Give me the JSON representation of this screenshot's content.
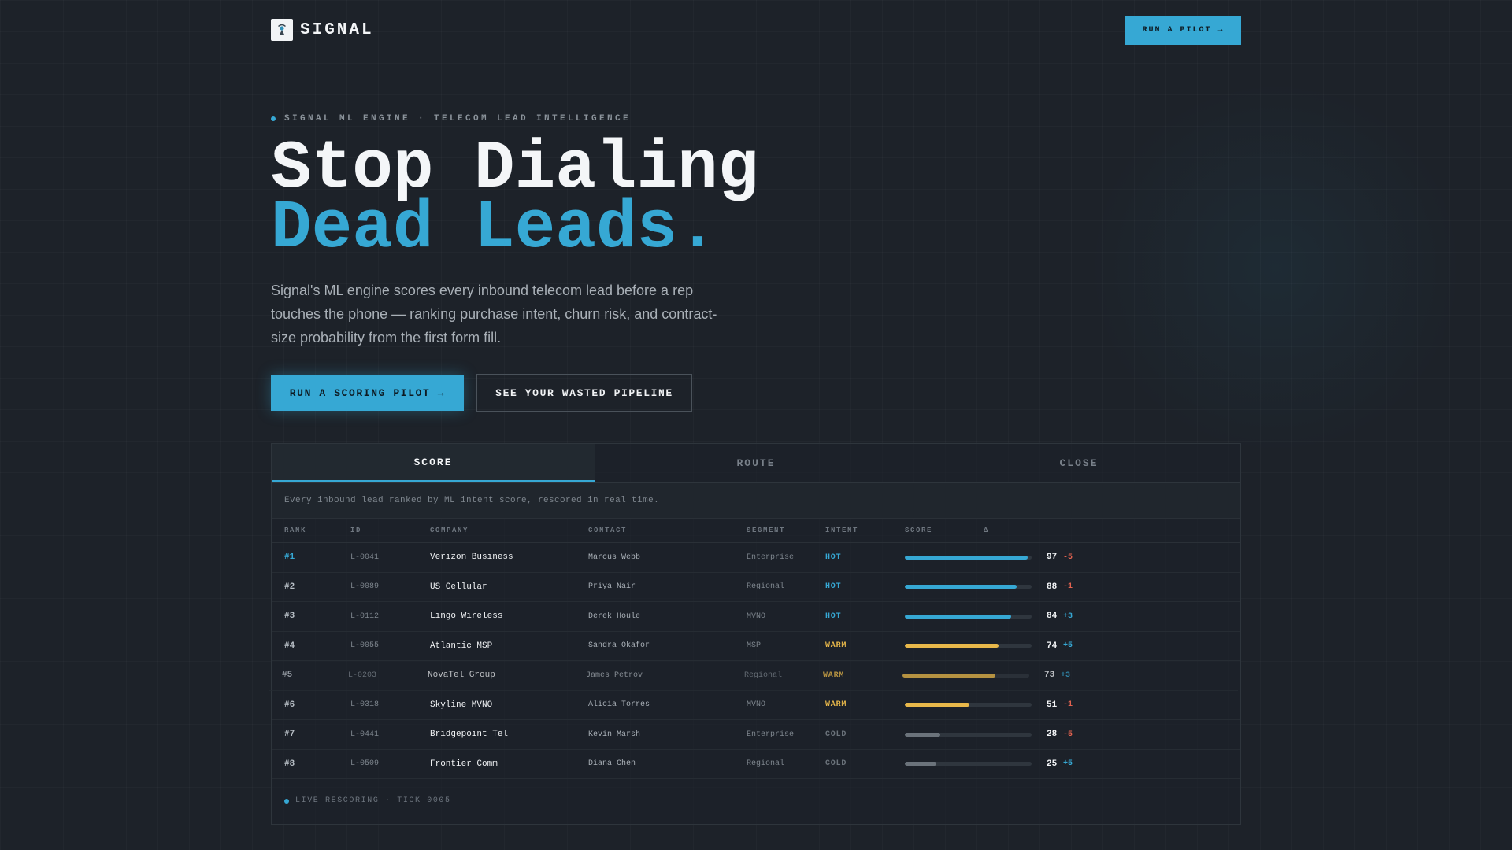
{
  "brand": {
    "name": "SIGNAL"
  },
  "nav": {
    "cta_label": "RUN A PILOT →"
  },
  "hero": {
    "eyebrow": "SIGNAL ML ENGINE · TELECOM LEAD INTELLIGENCE",
    "headline_line1": "Stop Dialing",
    "headline_line2": "Dead Leads.",
    "subtext": "Signal's ML engine scores every inbound telecom lead before a rep touches the phone — ranking purchase intent, churn risk, and contract-size probability from the first form fill.",
    "primary_cta": "RUN A SCORING PILOT →",
    "secondary_cta": "SEE YOUR WASTED PIPELINE"
  },
  "panel": {
    "tabs": [
      "SCORE",
      "ROUTE",
      "CLOSE"
    ],
    "active_tab": "SCORE",
    "caption": "Every inbound lead ranked by ML intent score, rescored in real time.",
    "columns": [
      "RANK",
      "ID",
      "COMPANY",
      "CONTACT",
      "SEGMENT",
      "INTENT",
      "SCORE",
      "Δ"
    ],
    "rows": [
      {
        "rank": "#1",
        "id": "L-0041",
        "company": "Verizon Business",
        "contact": "Marcus Webb",
        "segment": "Enterprise",
        "intent": "HOT",
        "score": 97,
        "delta": "-5"
      },
      {
        "rank": "#2",
        "id": "L-0089",
        "company": "US Cellular",
        "contact": "Priya Nair",
        "segment": "Regional",
        "intent": "HOT",
        "score": 88,
        "delta": "-1"
      },
      {
        "rank": "#3",
        "id": "L-0112",
        "company": "Lingo Wireless",
        "contact": "Derek Houle",
        "segment": "MVNO",
        "intent": "HOT",
        "score": 84,
        "delta": "+3"
      },
      {
        "rank": "#4",
        "id": "L-0055",
        "company": "Atlantic MSP",
        "contact": "Sandra Okafor",
        "segment": "MSP",
        "intent": "WARM",
        "score": 74,
        "delta": "+5"
      },
      {
        "rank": "#5",
        "id": "L-0203",
        "company": "NovaTel Group",
        "contact": "James Petrov",
        "segment": "Regional",
        "intent": "WARM",
        "score": 73,
        "delta": "+3"
      },
      {
        "rank": "#6",
        "id": "L-0318",
        "company": "Skyline MVNO",
        "contact": "Alicia Torres",
        "segment": "MVNO",
        "intent": "WARM",
        "score": 51,
        "delta": "-1"
      },
      {
        "rank": "#7",
        "id": "L-0441",
        "company": "Bridgepoint Tel",
        "contact": "Kevin Marsh",
        "segment": "Enterprise",
        "intent": "COLD",
        "score": 28,
        "delta": "-5"
      },
      {
        "rank": "#8",
        "id": "L-0509",
        "company": "Frontier Comm",
        "contact": "Diana Chen",
        "segment": "Regional",
        "intent": "COLD",
        "score": 25,
        "delta": "+5"
      }
    ],
    "live_status": "LIVE RESCORING · TICK 0005"
  },
  "colors": {
    "accent": "#36a8d4",
    "hot": "#36a8d4",
    "warm": "#e8b84a",
    "cold": "#6b737b",
    "delta_negative": "#e2624f",
    "delta_positive": "#36a8d4"
  },
  "icons": {
    "logo": "signal-tower-icon"
  }
}
